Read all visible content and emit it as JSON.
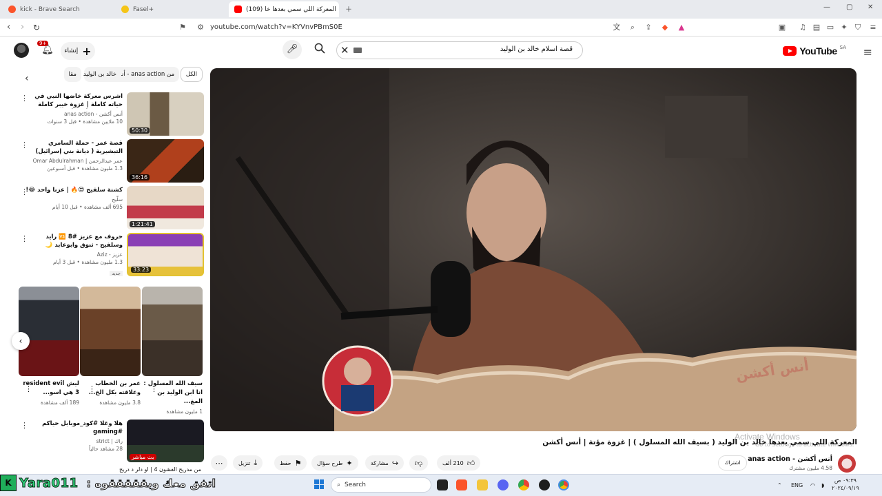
{
  "browser": {
    "tabs": [
      {
        "title": "kick - Brave Search",
        "active": false
      },
      {
        "title": "Fasel+",
        "active": false
      },
      {
        "title": "(109) المعركة اللي سمي بعدها خا",
        "active": true
      }
    ],
    "url": "youtube.com/watch?v=KYVnvPBmS0E"
  },
  "youtube": {
    "logo_text": "YouTube",
    "region": "SA",
    "search_query": "قصة اسلام خالد بن الوليد",
    "create_label": "إنشاء",
    "notifications_badge": "9+"
  },
  "chips": [
    {
      "label": "الكل",
      "selected": true
    },
    {
      "label": "من anas action - أنس أكشن",
      "selected": false
    },
    {
      "label": "خالد بن الوليد",
      "selected": false
    },
    {
      "label": "مقا",
      "selected": false
    }
  ],
  "sidebar_videos": [
    {
      "title": "اشرس معركة خاضها النبي في حياته كاملة | غزوة خيبر كاملة بالتفاصيل | أنس أكشن",
      "channel": "أنس أكشن - anas action",
      "views": "10 ملايين مشاهدة • قبل 3 سنوات",
      "duration": "50:30",
      "is_new": false
    },
    {
      "title": "قصة عمر - حملة السامري التبشيرية ( ديانة بني إسرائيل)",
      "channel": "عمر عبدالرحمن | Omar Abdulrahman",
      "views": "1.3 مليون مشاهدة • قبل أسبوعين",
      "duration": "36:16",
      "is_new": false
    },
    {
      "title": "كشتة سلفيح 😍🔥 | عزنا واحد 😂!",
      "channel": "سلّيح",
      "views": "695 ألف مشاهدة • قبل 10 أيام",
      "duration": "1:21:41",
      "is_new": false
    },
    {
      "title": "حروف مع عزيز #8 🆚 رايد وسلفيح - ثنوق وابوعابد 🌙 الموسم الثالث",
      "channel": "عزيز - Aziz",
      "views": "1.3 مليون مشاهدة • قبل 3 أيام",
      "duration": "33:23",
      "is_new": true,
      "new_label": "جديد"
    }
  ],
  "shorts": [
    {
      "title": "سيف الله المسلول : انا ابن الوليد بن المغ...",
      "views": "1 مليون مشاهدة"
    },
    {
      "title": "عمر بن الخطاب وعلاقته بكل الخ...",
      "views": "3.8 مليون مشاهدة"
    },
    {
      "title": "ليش resident evil 3 هي اسو...",
      "views": "189 ألف مشاهدة"
    }
  ],
  "bottom_video": {
    "title": "هلا وغلا #كود_موبايل حياكم #gaming",
    "channel": "راك | strict",
    "views": "28 مشاهد حالياً",
    "live_label": "بث مباشر"
  },
  "partial_next": "من مدريح الفشون 4 | او دلر د دريح",
  "main_video": {
    "title": "المعركة اللي سمي بعدها خالد بن الوليد ( بسيف الله المسلول ) | غزوة مؤتة | أنس أكشن",
    "channel": "أنس أكشن - anas action",
    "subscribers": "4.58 مليون مشترك",
    "subscribe_label": "اشتراك",
    "likes": "210 ألف",
    "share_label": "مشاركة",
    "ask_label": "طرح سؤال",
    "save_label": "حفظ",
    "download_label": "تنزيل",
    "watermark_text": "أنس أكشن"
  },
  "windows_activation": {
    "line1": "Activate Windows",
    "line2": "Go to Settings to activate Windows."
  },
  "stream_overlay": {
    "username": "Yara011",
    "message": "اتفق معك وبقققققوه :"
  },
  "taskbar": {
    "search_placeholder": "Search",
    "language": "ENG",
    "time": "٠٩:٣٩ ص",
    "date": "٢٠٢٤/٠٩/١٩"
  }
}
